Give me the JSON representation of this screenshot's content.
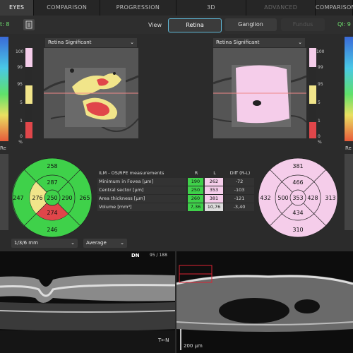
{
  "tabs": [
    {
      "label": "EYES",
      "state": "active"
    },
    {
      "label": "COMPARISON",
      "state": "normal"
    },
    {
      "label": "PROGRESSION",
      "state": "normal"
    },
    {
      "label": "3D",
      "state": "normal"
    },
    {
      "label": "ADVANCED",
      "state": "disabled"
    },
    {
      "label": "COMPARISON",
      "state": "normal"
    }
  ],
  "left_side_label": "t: 8",
  "right_side_label": "Ql: 9",
  "view": {
    "label": "View",
    "buttons": [
      {
        "label": "Retina",
        "state": "selected"
      },
      {
        "label": "Ganglion",
        "state": "normal"
      },
      {
        "label": "Fundus",
        "state": "disabled"
      }
    ]
  },
  "left_panel": {
    "dropdown": "Retina Significant"
  },
  "right_panel": {
    "dropdown": "Retina Significant"
  },
  "scale_labels": [
    "100",
    "99",
    "95",
    "5",
    "1",
    "0",
    "%"
  ],
  "side_strip_labels": {
    "left": "Re",
    "right": "Re"
  },
  "colors": {
    "green": "#3fd14a",
    "yellow": "#f1e58a",
    "red": "#e0464a",
    "pink": "#f5cdea",
    "gray": "#bbbbbb"
  },
  "left_chart": {
    "outer_top": "258",
    "outer_left": "247",
    "outer_right": "265",
    "outer_bottom": "246",
    "inner_top": "287",
    "inner_left": "276",
    "inner_right": "290",
    "inner_bottom": "274",
    "center": "250"
  },
  "right_chart": {
    "outer_top": "381",
    "outer_left": "432",
    "outer_right": "313",
    "outer_bottom": "310",
    "inner_top": "466",
    "inner_left": "500",
    "inner_right": "428",
    "inner_bottom": "434",
    "center": "353"
  },
  "measurements": {
    "header": [
      "ILM - OS/RPE measurements",
      "R",
      "L",
      "Diff (R-L)"
    ],
    "rows": [
      {
        "label": "Minimum in Fovea [µm]",
        "r": "190",
        "l": "262",
        "diff": "-72"
      },
      {
        "label": "Central sector [µm]",
        "r": "250",
        "l": "353",
        "diff": "-103"
      },
      {
        "label": "Area thickness [µm]",
        "r": "260",
        "l": "381",
        "diff": "-121"
      },
      {
        "label": "Volume [mm³]",
        "r": "7,36",
        "l": "10,76",
        "diff": "-3,40"
      }
    ]
  },
  "bottom_controls": {
    "grid_select": "1/3/6 mm",
    "mode_select": "Average"
  },
  "oct": {
    "direction": "DN",
    "slice": "95 / 188",
    "scale": "200 µm",
    "corner_label": "T←N"
  }
}
